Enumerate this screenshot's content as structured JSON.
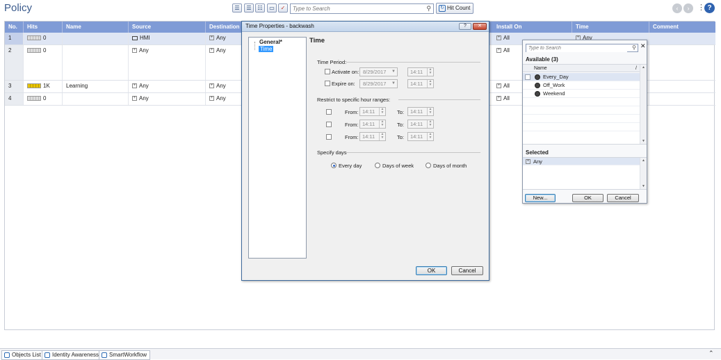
{
  "header": {
    "title": "Policy",
    "search_placeholder": "Type to Search",
    "hit_count_label": "Hit Count"
  },
  "table": {
    "columns": [
      "No.",
      "Hits",
      "Name",
      "Source",
      "Destination",
      "Install On",
      "Time",
      "Comment"
    ],
    "rows": [
      {
        "no": "1",
        "hits": "0",
        "name": "",
        "source": "HMI",
        "destination": "Any",
        "install_on": "All",
        "time": "Any"
      },
      {
        "no": "2",
        "hits": "0",
        "name": "",
        "source": "Any",
        "destination": "Any",
        "install_on": "All",
        "time": ""
      },
      {
        "no": "3",
        "hits": "1K",
        "name": "Learning",
        "source": "Any",
        "destination": "Any",
        "install_on": "All",
        "time": ""
      },
      {
        "no": "4",
        "hits": "0",
        "name": "",
        "source": "Any",
        "destination": "Any",
        "install_on": "All",
        "time": ""
      }
    ]
  },
  "dialog": {
    "title": "Time Properties - backwash",
    "tree": {
      "general": "General*",
      "time": "Time"
    },
    "pane_title": "Time",
    "time_period_label": "Time Period:",
    "activate_label": "Activate on:",
    "expire_label": "Expire on:",
    "activate_date": "8/29/2017",
    "expire_date": "8/29/2017",
    "activate_time": "14:11",
    "expire_time": "14:11",
    "restrict_label": "Restrict to specific hour ranges:",
    "ranges": [
      {
        "from_label": "From:",
        "from": "14:11",
        "to_label": "To:",
        "to": "14:11"
      },
      {
        "from_label": "From:",
        "from": "14:11",
        "to_label": "To:",
        "to": "14:11"
      },
      {
        "from_label": "From:",
        "from": "14:11",
        "to_label": "To:",
        "to": "14:11"
      }
    ],
    "specify_days_label": "Specify days",
    "every_day": "Every day",
    "days_of_week": "Days of week",
    "days_of_month": "Days of month",
    "ok": "OK",
    "cancel": "Cancel"
  },
  "picker": {
    "search_placeholder": "Type to Search",
    "available_label": "Available (3)",
    "name_header": "Name",
    "items": [
      "Every_Day",
      "Off_Work",
      "Weekend"
    ],
    "selected_label": "Selected",
    "selected_items": [
      "Any"
    ],
    "new_label": "New...",
    "ok": "OK",
    "cancel": "Cancel"
  },
  "bottom_tabs": [
    "Objects List",
    "Identity Awareness",
    "SmartWorkflow"
  ],
  "colors": {
    "header_blue": "#7f9bd6",
    "accent": "#2f63b0",
    "hit_level": "#e8c400"
  }
}
